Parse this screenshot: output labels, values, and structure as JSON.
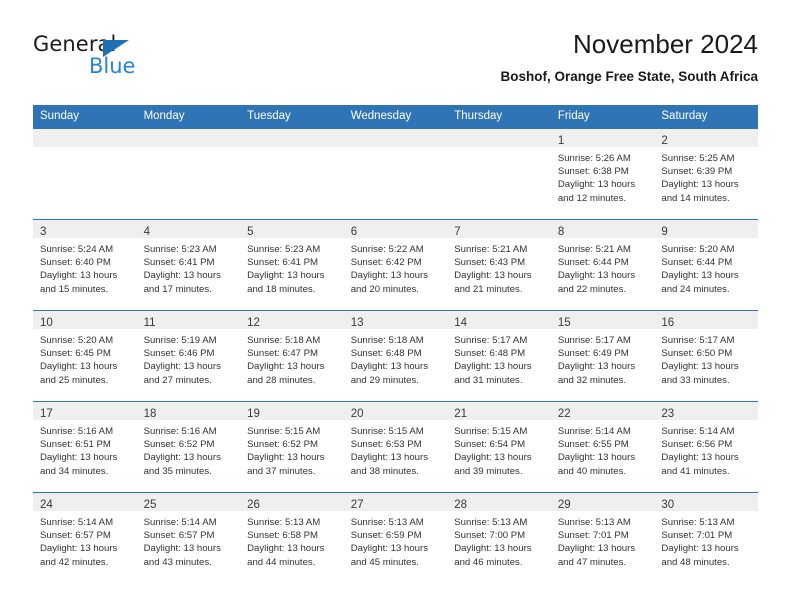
{
  "brand": {
    "word_one": "General",
    "word_two": "Blue",
    "triangle_color": "#1f6fb5",
    "blue_text_color": "#2585d3"
  },
  "header": {
    "title": "November 2024",
    "subtitle": "Boshof, Orange Free State, South Africa"
  },
  "theme": {
    "header_blue": "#2f74b5",
    "daynum_band": "#efefef",
    "text": "#333333"
  },
  "weekdays": [
    "Sunday",
    "Monday",
    "Tuesday",
    "Wednesday",
    "Thursday",
    "Friday",
    "Saturday"
  ],
  "weeks": [
    [
      {
        "day": "",
        "sunrise": "",
        "sunset": "",
        "daylight_1": "",
        "daylight_2": ""
      },
      {
        "day": "",
        "sunrise": "",
        "sunset": "",
        "daylight_1": "",
        "daylight_2": ""
      },
      {
        "day": "",
        "sunrise": "",
        "sunset": "",
        "daylight_1": "",
        "daylight_2": ""
      },
      {
        "day": "",
        "sunrise": "",
        "sunset": "",
        "daylight_1": "",
        "daylight_2": ""
      },
      {
        "day": "",
        "sunrise": "",
        "sunset": "",
        "daylight_1": "",
        "daylight_2": ""
      },
      {
        "day": "1",
        "sunrise": "Sunrise: 5:26 AM",
        "sunset": "Sunset: 6:38 PM",
        "daylight_1": "Daylight: 13 hours",
        "daylight_2": "and 12 minutes."
      },
      {
        "day": "2",
        "sunrise": "Sunrise: 5:25 AM",
        "sunset": "Sunset: 6:39 PM",
        "daylight_1": "Daylight: 13 hours",
        "daylight_2": "and 14 minutes."
      }
    ],
    [
      {
        "day": "3",
        "sunrise": "Sunrise: 5:24 AM",
        "sunset": "Sunset: 6:40 PM",
        "daylight_1": "Daylight: 13 hours",
        "daylight_2": "and 15 minutes."
      },
      {
        "day": "4",
        "sunrise": "Sunrise: 5:23 AM",
        "sunset": "Sunset: 6:41 PM",
        "daylight_1": "Daylight: 13 hours",
        "daylight_2": "and 17 minutes."
      },
      {
        "day": "5",
        "sunrise": "Sunrise: 5:23 AM",
        "sunset": "Sunset: 6:41 PM",
        "daylight_1": "Daylight: 13 hours",
        "daylight_2": "and 18 minutes."
      },
      {
        "day": "6",
        "sunrise": "Sunrise: 5:22 AM",
        "sunset": "Sunset: 6:42 PM",
        "daylight_1": "Daylight: 13 hours",
        "daylight_2": "and 20 minutes."
      },
      {
        "day": "7",
        "sunrise": "Sunrise: 5:21 AM",
        "sunset": "Sunset: 6:43 PM",
        "daylight_1": "Daylight: 13 hours",
        "daylight_2": "and 21 minutes."
      },
      {
        "day": "8",
        "sunrise": "Sunrise: 5:21 AM",
        "sunset": "Sunset: 6:44 PM",
        "daylight_1": "Daylight: 13 hours",
        "daylight_2": "and 22 minutes."
      },
      {
        "day": "9",
        "sunrise": "Sunrise: 5:20 AM",
        "sunset": "Sunset: 6:44 PM",
        "daylight_1": "Daylight: 13 hours",
        "daylight_2": "and 24 minutes."
      }
    ],
    [
      {
        "day": "10",
        "sunrise": "Sunrise: 5:20 AM",
        "sunset": "Sunset: 6:45 PM",
        "daylight_1": "Daylight: 13 hours",
        "daylight_2": "and 25 minutes."
      },
      {
        "day": "11",
        "sunrise": "Sunrise: 5:19 AM",
        "sunset": "Sunset: 6:46 PM",
        "daylight_1": "Daylight: 13 hours",
        "daylight_2": "and 27 minutes."
      },
      {
        "day": "12",
        "sunrise": "Sunrise: 5:18 AM",
        "sunset": "Sunset: 6:47 PM",
        "daylight_1": "Daylight: 13 hours",
        "daylight_2": "and 28 minutes."
      },
      {
        "day": "13",
        "sunrise": "Sunrise: 5:18 AM",
        "sunset": "Sunset: 6:48 PM",
        "daylight_1": "Daylight: 13 hours",
        "daylight_2": "and 29 minutes."
      },
      {
        "day": "14",
        "sunrise": "Sunrise: 5:17 AM",
        "sunset": "Sunset: 6:48 PM",
        "daylight_1": "Daylight: 13 hours",
        "daylight_2": "and 31 minutes."
      },
      {
        "day": "15",
        "sunrise": "Sunrise: 5:17 AM",
        "sunset": "Sunset: 6:49 PM",
        "daylight_1": "Daylight: 13 hours",
        "daylight_2": "and 32 minutes."
      },
      {
        "day": "16",
        "sunrise": "Sunrise: 5:17 AM",
        "sunset": "Sunset: 6:50 PM",
        "daylight_1": "Daylight: 13 hours",
        "daylight_2": "and 33 minutes."
      }
    ],
    [
      {
        "day": "17",
        "sunrise": "Sunrise: 5:16 AM",
        "sunset": "Sunset: 6:51 PM",
        "daylight_1": "Daylight: 13 hours",
        "daylight_2": "and 34 minutes."
      },
      {
        "day": "18",
        "sunrise": "Sunrise: 5:16 AM",
        "sunset": "Sunset: 6:52 PM",
        "daylight_1": "Daylight: 13 hours",
        "daylight_2": "and 35 minutes."
      },
      {
        "day": "19",
        "sunrise": "Sunrise: 5:15 AM",
        "sunset": "Sunset: 6:52 PM",
        "daylight_1": "Daylight: 13 hours",
        "daylight_2": "and 37 minutes."
      },
      {
        "day": "20",
        "sunrise": "Sunrise: 5:15 AM",
        "sunset": "Sunset: 6:53 PM",
        "daylight_1": "Daylight: 13 hours",
        "daylight_2": "and 38 minutes."
      },
      {
        "day": "21",
        "sunrise": "Sunrise: 5:15 AM",
        "sunset": "Sunset: 6:54 PM",
        "daylight_1": "Daylight: 13 hours",
        "daylight_2": "and 39 minutes."
      },
      {
        "day": "22",
        "sunrise": "Sunrise: 5:14 AM",
        "sunset": "Sunset: 6:55 PM",
        "daylight_1": "Daylight: 13 hours",
        "daylight_2": "and 40 minutes."
      },
      {
        "day": "23",
        "sunrise": "Sunrise: 5:14 AM",
        "sunset": "Sunset: 6:56 PM",
        "daylight_1": "Daylight: 13 hours",
        "daylight_2": "and 41 minutes."
      }
    ],
    [
      {
        "day": "24",
        "sunrise": "Sunrise: 5:14 AM",
        "sunset": "Sunset: 6:57 PM",
        "daylight_1": "Daylight: 13 hours",
        "daylight_2": "and 42 minutes."
      },
      {
        "day": "25",
        "sunrise": "Sunrise: 5:14 AM",
        "sunset": "Sunset: 6:57 PM",
        "daylight_1": "Daylight: 13 hours",
        "daylight_2": "and 43 minutes."
      },
      {
        "day": "26",
        "sunrise": "Sunrise: 5:13 AM",
        "sunset": "Sunset: 6:58 PM",
        "daylight_1": "Daylight: 13 hours",
        "daylight_2": "and 44 minutes."
      },
      {
        "day": "27",
        "sunrise": "Sunrise: 5:13 AM",
        "sunset": "Sunset: 6:59 PM",
        "daylight_1": "Daylight: 13 hours",
        "daylight_2": "and 45 minutes."
      },
      {
        "day": "28",
        "sunrise": "Sunrise: 5:13 AM",
        "sunset": "Sunset: 7:00 PM",
        "daylight_1": "Daylight: 13 hours",
        "daylight_2": "and 46 minutes."
      },
      {
        "day": "29",
        "sunrise": "Sunrise: 5:13 AM",
        "sunset": "Sunset: 7:01 PM",
        "daylight_1": "Daylight: 13 hours",
        "daylight_2": "and 47 minutes."
      },
      {
        "day": "30",
        "sunrise": "Sunrise: 5:13 AM",
        "sunset": "Sunset: 7:01 PM",
        "daylight_1": "Daylight: 13 hours",
        "daylight_2": "and 48 minutes."
      }
    ]
  ]
}
